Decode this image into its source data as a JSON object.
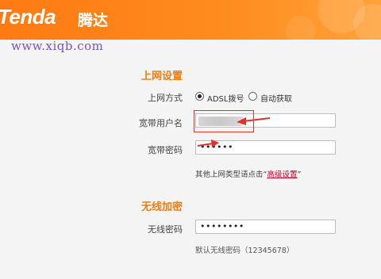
{
  "brand": {
    "logo_text": "Tenda",
    "logo_cn": "腾达"
  },
  "watermark": "www.xiqb.com",
  "internet": {
    "section_title": "上网设置",
    "mode_label": "上网方式",
    "mode_options": [
      {
        "label": "ADSL拨号",
        "selected": true
      },
      {
        "label": "自动获取",
        "selected": false
      }
    ],
    "username_label": "宽带用户名",
    "username_value": "",
    "password_label": "宽带密码",
    "password_value": "••••••",
    "hint_prefix": "其他上网类型请点击“",
    "hint_link": "高级设置",
    "hint_suffix": "”"
  },
  "wireless": {
    "section_title": "无线加密",
    "password_label": "无线密码",
    "password_value": "••••••••",
    "default_hint": "默认无线密码（12345678）"
  },
  "colors": {
    "header_orange": "#ff8214",
    "section_title_orange": "#f07d10",
    "annotation_red": "#e0312b",
    "link_red": "#c0002a"
  }
}
